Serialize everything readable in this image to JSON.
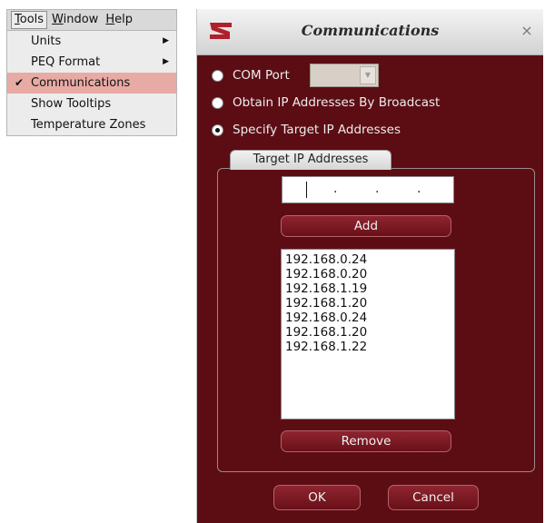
{
  "menu": {
    "bar": [
      {
        "label": "Tools",
        "accel": "T",
        "rest": "ools",
        "active": true
      },
      {
        "label": "Window",
        "accel": "W",
        "rest": "indow",
        "active": false
      },
      {
        "label": "Help",
        "accel": "H",
        "rest": "elp",
        "active": false
      }
    ],
    "items": [
      {
        "label": "Units",
        "submenu": true,
        "checked": false,
        "selected": false
      },
      {
        "label": "PEQ Format",
        "submenu": true,
        "checked": false,
        "selected": false
      },
      {
        "label": "Communications",
        "submenu": false,
        "checked": true,
        "selected": true
      },
      {
        "label": "Show Tooltips",
        "submenu": false,
        "checked": false,
        "selected": false
      },
      {
        "label": "Temperature Zones",
        "submenu": false,
        "checked": false,
        "selected": false
      }
    ]
  },
  "dialog": {
    "title": "Communications",
    "close_glyph": "×",
    "options": {
      "com_port": "COM Port",
      "broadcast": "Obtain IP Addresses By Broadcast",
      "specify": "Specify Target IP Addresses",
      "selected": "specify"
    },
    "tab_label": "Target IP Addresses",
    "ip_input_value": "",
    "add_label": "Add",
    "ip_list": [
      "192.168.0.24",
      "192.168.0.20",
      "192.168.1.19",
      "192.168.1.20",
      "192.168.0.24",
      "192.168.1.20",
      "192.168.1.22"
    ],
    "remove_label": "Remove",
    "ok_label": "OK",
    "cancel_label": "Cancel"
  },
  "colors": {
    "dialog_bg": "#5c0d14",
    "button_bg": "#7e1a24",
    "menu_selected": "#e8aaa5",
    "logo_red": "#b0202c"
  }
}
